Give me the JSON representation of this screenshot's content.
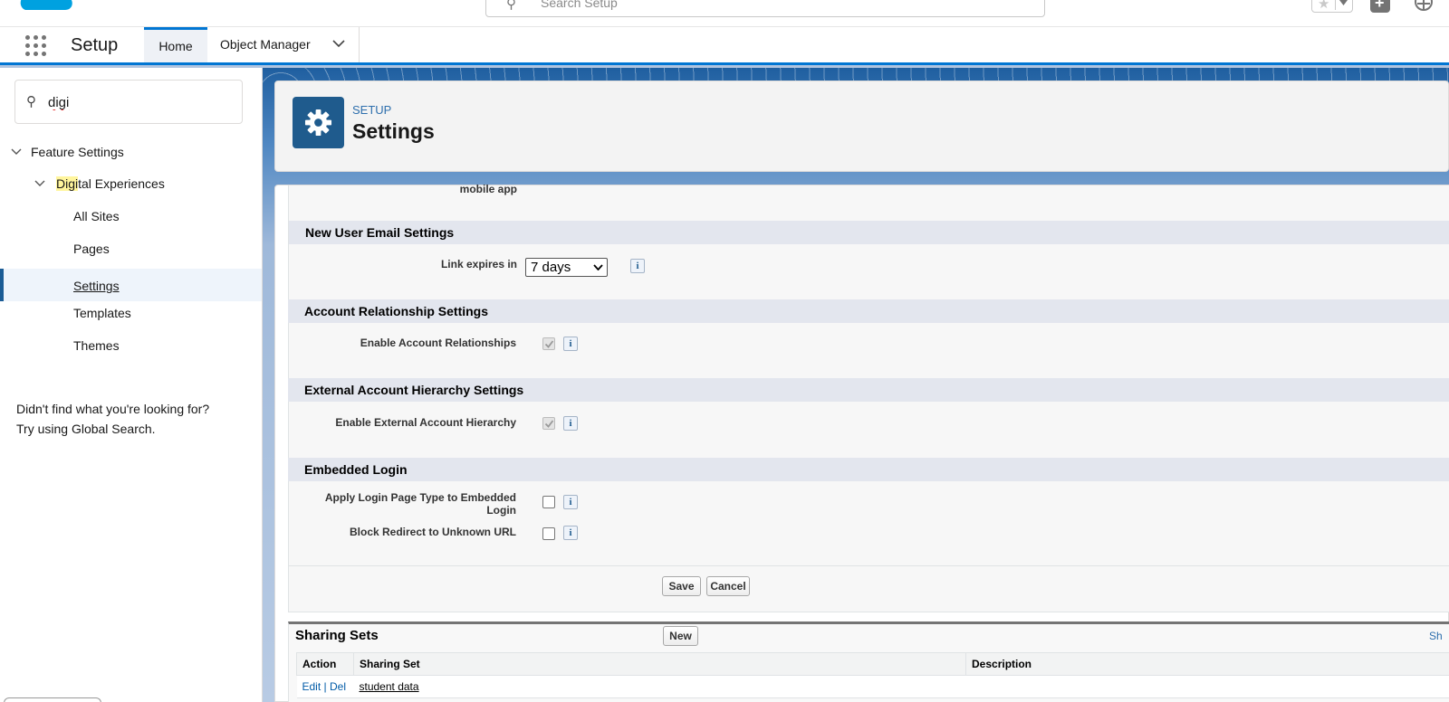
{
  "header": {
    "search_placeholder": "Search Setup",
    "favorites_icon": "star-icon",
    "add_icon": "plus-icon"
  },
  "context_bar": {
    "app_name": "Setup",
    "tabs": [
      {
        "label": "Home",
        "active": true
      },
      {
        "label": "Object Manager",
        "has_dropdown": true
      }
    ]
  },
  "sidebar": {
    "quick_find_value": "digi",
    "tree": {
      "feature_settings": "Feature Settings",
      "digital_experiences_highlight": "Digi",
      "digital_experiences_rest": "tal Experiences",
      "children": [
        "All Sites",
        "Pages",
        "Settings",
        "Templates",
        "Themes"
      ],
      "selected": "Settings"
    },
    "help_line1": "Didn't find what you're looking for?",
    "help_line2": "Try using Global Search."
  },
  "page_header": {
    "eyebrow": "SETUP",
    "title": "Settings",
    "icon": "gear-icon"
  },
  "form": {
    "partial_label": "mobile app",
    "sections": {
      "new_user_email": {
        "title": "New User Email Settings",
        "link_expires_label": "Link expires in",
        "link_expires_value": "7 days"
      },
      "account_relationship": {
        "title": "Account Relationship Settings",
        "enable_label": "Enable Account Relationships",
        "enabled": true
      },
      "external_hierarchy": {
        "title": "External Account Hierarchy Settings",
        "enable_label": "Enable External Account Hierarchy",
        "enabled": true
      },
      "embedded_login": {
        "title": "Embedded Login",
        "apply_label_line1": "Apply Login Page Type to Embedded",
        "apply_label_line2": "Login",
        "apply_checked": false,
        "block_label": "Block Redirect to Unknown URL",
        "block_checked": false
      }
    },
    "save_label": "Save",
    "cancel_label": "Cancel",
    "info_glyph": "i"
  },
  "sharing_sets": {
    "title": "Sharing Sets",
    "new_label": "New",
    "help_link": "Sh",
    "columns": [
      "Action",
      "Sharing Set",
      "Description"
    ],
    "rows": [
      {
        "edit": "Edit",
        "separator": " | ",
        "del": "Del",
        "name": "student data",
        "description": ""
      }
    ]
  },
  "colors": {
    "brand_blue": "#0176d3",
    "header_icon_bg": "#1f5b8d",
    "section_bar": "#e3e6ee"
  }
}
